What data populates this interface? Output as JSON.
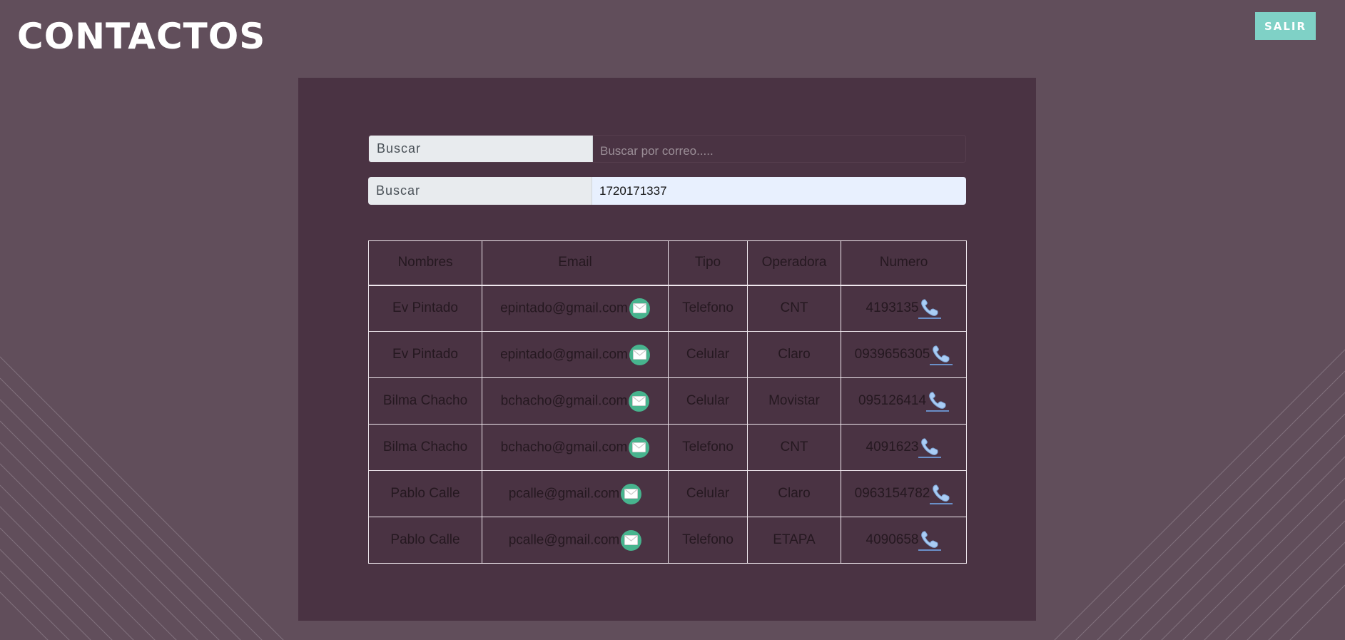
{
  "header": {
    "title": "CONTACTOS",
    "logout_label": "SALIR"
  },
  "search": {
    "email": {
      "label": "Buscar",
      "placeholder": "Buscar por correo.....",
      "value": ""
    },
    "id": {
      "label": "Buscar",
      "placeholder": "",
      "value": "1720171337"
    }
  },
  "table": {
    "columns": [
      "Nombres",
      "Email",
      "Tipo",
      "Operadora",
      "Numero"
    ],
    "rows": [
      {
        "name": "Ev Pintado",
        "email": "epintado@gmail.com",
        "type": "Telefono",
        "operator": "CNT",
        "number": "4193135"
      },
      {
        "name": "Ev Pintado",
        "email": "epintado@gmail.com",
        "type": "Celular",
        "operator": "Claro",
        "number": "0939656305"
      },
      {
        "name": "Bilma Chacho",
        "email": "bchacho@gmail.com",
        "type": "Celular",
        "operator": "Movistar",
        "number": "095126414"
      },
      {
        "name": "Bilma Chacho",
        "email": "bchacho@gmail.com",
        "type": "Telefono",
        "operator": "CNT",
        "number": "4091623"
      },
      {
        "name": "Pablo Calle",
        "email": "pcalle@gmail.com",
        "type": "Celular",
        "operator": "Claro",
        "number": "0963154782"
      },
      {
        "name": "Pablo Calle",
        "email": "pcalle@gmail.com",
        "type": "Telefono",
        "operator": "ETAPA",
        "number": "4090658"
      }
    ]
  },
  "icons": {
    "email": "mail-icon",
    "phone": "phone-icon"
  },
  "colors": {
    "background": "#614e5b",
    "panel": "#4a3343",
    "logout_button": "#7fd1c6",
    "mail_icon": "#47b48e",
    "phone_icon": "#a9cdf5"
  }
}
